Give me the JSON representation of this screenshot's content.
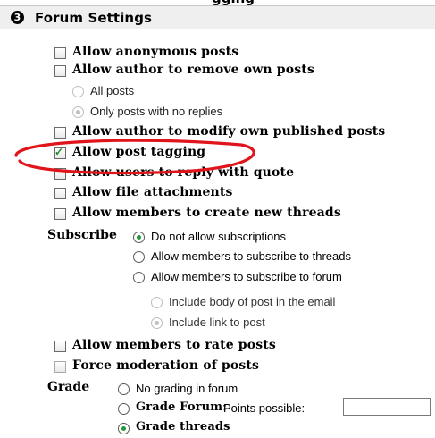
{
  "top_partial_text": "gging",
  "header": {
    "step_number": "3",
    "title": "Forum Settings"
  },
  "options": {
    "anonymous_posts": {
      "label": "Allow anonymous posts",
      "checked": false
    },
    "author_remove": {
      "label": "Allow author to remove own posts",
      "checked": false
    },
    "author_remove_all": {
      "label": "All posts",
      "selected": false
    },
    "author_remove_no_replies": {
      "label": "Only posts with no replies",
      "selected": true
    },
    "author_modify": {
      "label": "Allow author to modify own published posts",
      "checked": false
    },
    "post_tagging": {
      "label": "Allow post tagging",
      "checked": true
    },
    "reply_with_quote": {
      "label": "Allow users to reply with quote",
      "checked": false
    },
    "file_attachments": {
      "label": "Allow file attachments",
      "checked": false
    },
    "create_threads": {
      "label": "Allow members to create new threads",
      "checked": false
    }
  },
  "subscribe": {
    "label": "Subscribe",
    "none": "Do not allow subscriptions",
    "threads": "Allow members to subscribe to threads",
    "forum": "Allow members to subscribe to forum",
    "include_body": "Include body of post in the email",
    "include_link": "Include link to post",
    "selected": "none"
  },
  "rate_posts": {
    "label": "Allow members to rate posts",
    "checked": false
  },
  "force_moderation": {
    "label": "Force moderation of posts",
    "checked": false
  },
  "grade": {
    "label": "Grade",
    "no_grading": "No grading in forum",
    "grade_forum": "Grade Forum:",
    "points_possible": "Points possible:",
    "grade_threads": "Grade threads",
    "selected": "grade_threads",
    "points_value": ""
  },
  "annotation_color": "#e0151b",
  "check_color": "#2a8a2a",
  "radio_selected_color": "#1e9a3c"
}
